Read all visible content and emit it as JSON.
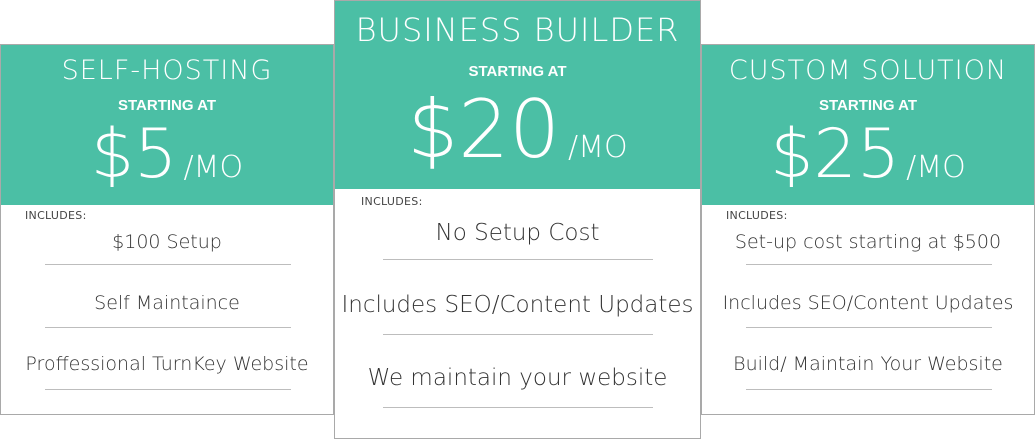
{
  "colors": {
    "accent": "#4bbfa5",
    "header_text": "#ffffff",
    "body_text": "#333333",
    "divider": "#bdbdbd",
    "border": "#a9a9a9"
  },
  "plans": [
    {
      "name": "SELF-HOSTING",
      "starting_label": "STARTING AT",
      "price": "$5",
      "period": "/MO",
      "includes_label": "INCLUDES:",
      "features": [
        "$100 Setup",
        "Self Maintaince",
        "Proffessional TurnKey Website"
      ]
    },
    {
      "name": "BUSINESS BUILDER",
      "starting_label": "STARTING AT",
      "price": "$20",
      "period": "/MO",
      "includes_label": "INCLUDES:",
      "features": [
        "No Setup Cost",
        "Includes SEO/Content Updates",
        "We maintain your website"
      ]
    },
    {
      "name": "CUSTOM SOLUTION",
      "starting_label": "STARTING AT",
      "price": "$25",
      "period": "/MO",
      "includes_label": "INCLUDES:",
      "features": [
        "Set-up cost starting at $500",
        "Includes SEO/Content Updates",
        "Build/ Maintain Your Website"
      ]
    }
  ]
}
